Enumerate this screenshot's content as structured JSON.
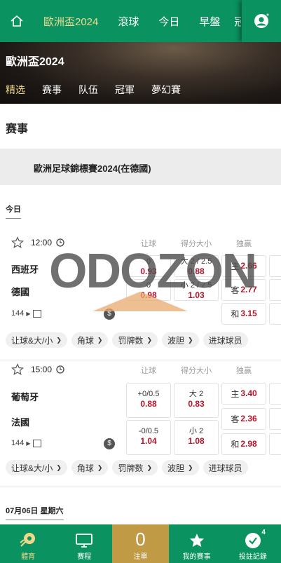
{
  "topnav": {
    "home_icon": "home-icon",
    "links": [
      "歐洲盃2024",
      "滾球",
      "今日",
      "早盤",
      "冠"
    ],
    "user_icon": "user-icon"
  },
  "banner": {
    "title": "歐洲盃2024",
    "tabs": [
      "精选",
      "赛事",
      "队伍",
      "冠軍",
      "夢幻賽"
    ]
  },
  "section_title": "赛事",
  "league_name": "歐洲足球錦標賽2024(在德國)",
  "date_today": "今日",
  "date_next": "07月06日 星期六",
  "column_headers": {
    "handicap": "让球",
    "over_under": "得分大小",
    "one_x_two": "独赢"
  },
  "matches": [
    {
      "time": "12:00",
      "home": "西班牙",
      "away": "德國",
      "markets_count": "144",
      "handicap": [
        {
          "line": "0",
          "odd": "0.93"
        },
        {
          "line": "0",
          "odd": "0.98"
        }
      ],
      "over_under": [
        {
          "line": "大 2 / 2.5",
          "odd": "0.88"
        },
        {
          "line": "小 2 / 2.5",
          "odd": "1.03"
        }
      ],
      "one_x_two": [
        {
          "label": "主",
          "odd": "2.66"
        },
        {
          "label": "客",
          "odd": "2.77"
        },
        {
          "label": "和",
          "odd": "3.15"
        }
      ]
    },
    {
      "time": "15:00",
      "home": "葡萄牙",
      "away": "法國",
      "markets_count": "144",
      "handicap": [
        {
          "line": "+0/0.5",
          "odd": "0.88"
        },
        {
          "line": "-0/0.5",
          "odd": "1.04"
        }
      ],
      "over_under": [
        {
          "line": "大 2",
          "odd": "0.83"
        },
        {
          "line": "小 2",
          "odd": "1.08"
        }
      ],
      "one_x_two": [
        {
          "label": "主",
          "odd": "3.40"
        },
        {
          "label": "客",
          "odd": "2.36"
        },
        {
          "label": "和",
          "odd": "2.98"
        }
      ]
    }
  ],
  "chips": [
    "让球&大/小",
    "角球",
    "罚牌数",
    "波胆",
    "进球球员"
  ],
  "watermark": "ODOZON",
  "bottombar": {
    "items": [
      {
        "label": "體育",
        "icon": "soccer-ball-icon"
      },
      {
        "label": "赛程",
        "icon": "monitor-icon"
      },
      {
        "label": "注單",
        "count": "0"
      },
      {
        "label": "我的赛事",
        "icon": "star-icon"
      },
      {
        "label": "投註記錄",
        "icon": "check-circle-icon",
        "badge": "4"
      }
    ]
  },
  "colors": {
    "brand_green": "#0a9361",
    "accent_gold": "#f0d98a",
    "odd_red": "#b5152b",
    "betslip_gold": "#c09a45"
  }
}
